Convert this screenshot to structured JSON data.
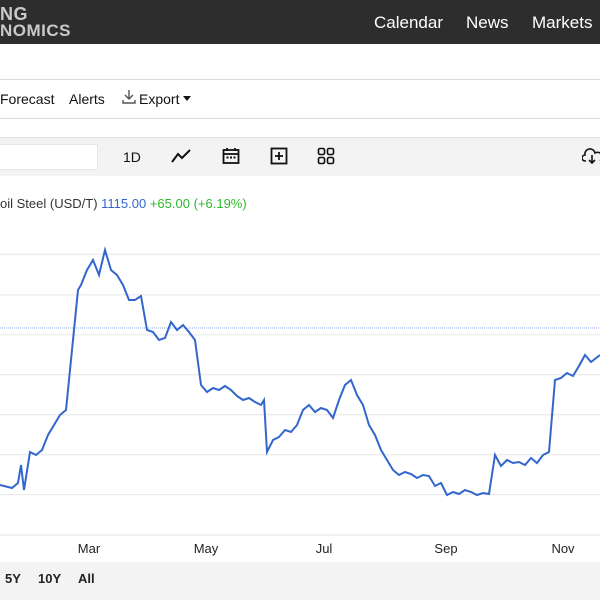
{
  "header": {
    "logo_line1": "NG",
    "logo_line2": "NOMICS",
    "nav": [
      "Calendar",
      "News",
      "Markets"
    ]
  },
  "menu": {
    "forecast": "Forecast",
    "alerts": "Alerts",
    "export": "Export"
  },
  "toolbar": {
    "period": "1D",
    "icons": [
      "line-chart-icon",
      "calendar-icon",
      "add-series-icon",
      "grid-icon",
      "cloud-download-icon"
    ]
  },
  "legend": {
    "name": "oil Steel (USD/T)",
    "price": "1115.00",
    "change": "+65.00 (+6.19%)"
  },
  "ranges": [
    "5Y",
    "10Y",
    "All"
  ],
  "colors": {
    "line": "#3366cc",
    "change_positive": "#2eb82e",
    "nav_bg": "#2d2d2d"
  },
  "chart_data": {
    "type": "line",
    "title": "",
    "xlabel": "",
    "ylabel": "",
    "x_tick_labels": [
      "Mar",
      "May",
      "Jul",
      "Sep",
      "Nov"
    ],
    "grid": true,
    "legend_position": "top-left",
    "current_value": 1115.0,
    "series": [
      {
        "name": "oil Steel (USD/T)",
        "points": [
          [
            0.0,
            485
          ],
          [
            0.02,
            488
          ],
          [
            0.03,
            483
          ],
          [
            0.035,
            465
          ],
          [
            0.04,
            490
          ],
          [
            0.05,
            452
          ],
          [
            0.06,
            455
          ],
          [
            0.07,
            450
          ],
          [
            0.08,
            435
          ],
          [
            0.09,
            425
          ],
          [
            0.1,
            415
          ],
          [
            0.11,
            410
          ],
          [
            0.12,
            350
          ],
          [
            0.13,
            290
          ],
          [
            0.135,
            285
          ],
          [
            0.145,
            270
          ],
          [
            0.155,
            260
          ],
          [
            0.165,
            275
          ],
          [
            0.175,
            250
          ],
          [
            0.185,
            270
          ],
          [
            0.195,
            275
          ],
          [
            0.205,
            285
          ],
          [
            0.215,
            300
          ],
          [
            0.225,
            300
          ],
          [
            0.235,
            296
          ],
          [
            0.245,
            330
          ],
          [
            0.255,
            332
          ],
          [
            0.265,
            340
          ],
          [
            0.275,
            338
          ],
          [
            0.285,
            322
          ],
          [
            0.295,
            330
          ],
          [
            0.305,
            325
          ],
          [
            0.315,
            332
          ],
          [
            0.325,
            340
          ],
          [
            0.335,
            385
          ],
          [
            0.345,
            392
          ],
          [
            0.355,
            388
          ],
          [
            0.365,
            390
          ],
          [
            0.375,
            386
          ],
          [
            0.385,
            390
          ],
          [
            0.395,
            396
          ],
          [
            0.405,
            400
          ],
          [
            0.415,
            398
          ],
          [
            0.425,
            402
          ],
          [
            0.435,
            405
          ],
          [
            0.44,
            400
          ],
          [
            0.445,
            452
          ],
          [
            0.455,
            440
          ],
          [
            0.465,
            437
          ],
          [
            0.475,
            430
          ],
          [
            0.485,
            432
          ],
          [
            0.495,
            425
          ],
          [
            0.505,
            410
          ],
          [
            0.515,
            405
          ],
          [
            0.525,
            412
          ],
          [
            0.535,
            408
          ],
          [
            0.545,
            410
          ],
          [
            0.555,
            418
          ],
          [
            0.565,
            400
          ],
          [
            0.575,
            385
          ],
          [
            0.585,
            380
          ],
          [
            0.595,
            395
          ],
          [
            0.605,
            405
          ],
          [
            0.615,
            425
          ],
          [
            0.625,
            435
          ],
          [
            0.635,
            450
          ],
          [
            0.645,
            460
          ],
          [
            0.655,
            470
          ],
          [
            0.665,
            475
          ],
          [
            0.675,
            472
          ],
          [
            0.685,
            474
          ],
          [
            0.695,
            478
          ],
          [
            0.705,
            475
          ],
          [
            0.715,
            476
          ],
          [
            0.725,
            486
          ],
          [
            0.735,
            483
          ],
          [
            0.745,
            495
          ],
          [
            0.755,
            492
          ],
          [
            0.765,
            494
          ],
          [
            0.775,
            490
          ],
          [
            0.785,
            492
          ],
          [
            0.795,
            495
          ],
          [
            0.805,
            493
          ],
          [
            0.815,
            494
          ],
          [
            0.825,
            455
          ],
          [
            0.835,
            466
          ],
          [
            0.845,
            460
          ],
          [
            0.855,
            463
          ],
          [
            0.865,
            462
          ],
          [
            0.875,
            465
          ],
          [
            0.885,
            458
          ],
          [
            0.895,
            463
          ],
          [
            0.905,
            455
          ],
          [
            0.915,
            452
          ],
          [
            0.925,
            380
          ],
          [
            0.935,
            378
          ],
          [
            0.945,
            373
          ],
          [
            0.955,
            376
          ],
          [
            0.965,
            366
          ],
          [
            0.975,
            355
          ],
          [
            0.985,
            362
          ],
          [
            1.0,
            355
          ]
        ]
      }
    ]
  }
}
